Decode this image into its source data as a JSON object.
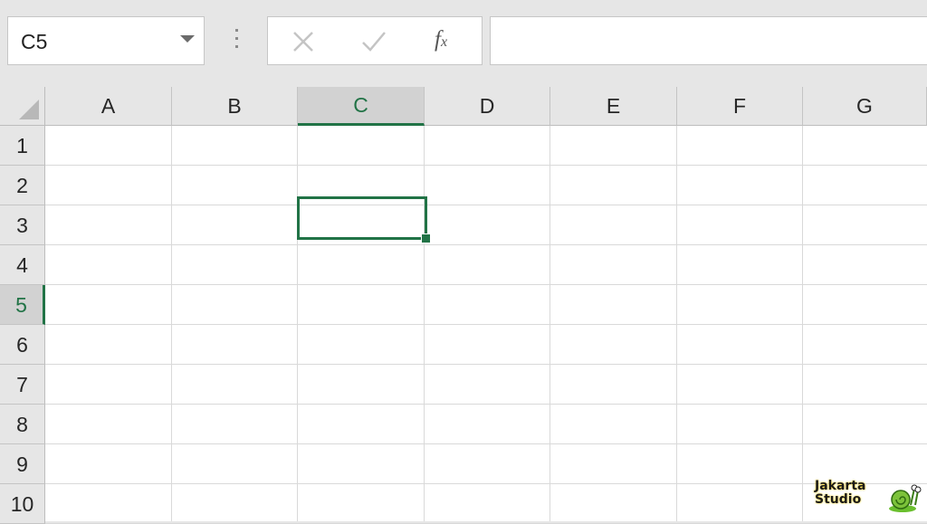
{
  "formula_bar": {
    "name_box": "C5",
    "fx_label": "f",
    "fx_sub": "x",
    "formula_value": ""
  },
  "grid": {
    "columns": [
      "A",
      "B",
      "C",
      "D",
      "E",
      "F",
      "G"
    ],
    "rows": [
      "1",
      "2",
      "3",
      "4",
      "5",
      "6",
      "7",
      "8",
      "9",
      "10"
    ],
    "selected_column": "C",
    "selected_row": "5"
  },
  "watermark": {
    "line1": "Jakarta",
    "line2": "Studio"
  },
  "colors": {
    "accent": "#217346",
    "header_bg": "#e6e6e6",
    "selected_header_bg": "#d2d2d2",
    "gridline": "#d9d9d9"
  }
}
